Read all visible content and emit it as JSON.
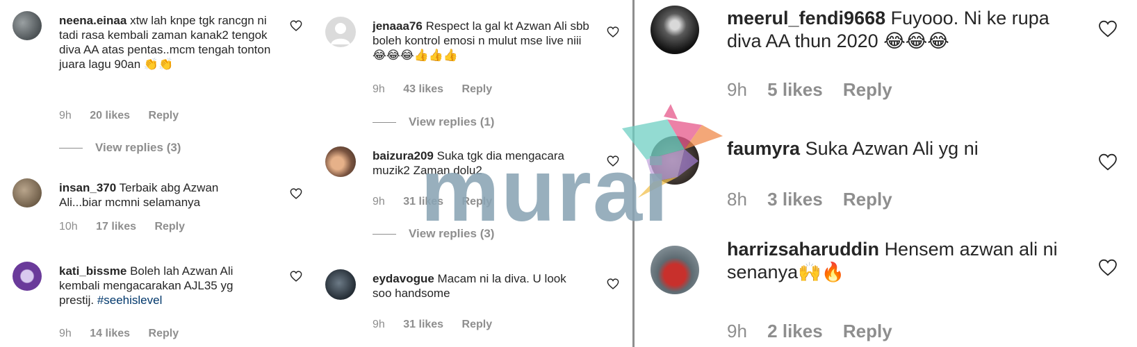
{
  "left_panel": {
    "comments": [
      {
        "username": "neena.einaa",
        "text": "xtw lah knpe tgk rancgn ni tadi rasa kembali zaman kanak2 tengok diva AA atas pentas..mcm tengah tonton juara lagu 90an 👏👏",
        "time": "9h",
        "likes": "20 likes",
        "reply": "Reply",
        "view_replies": "View replies (3)"
      },
      {
        "username": "insan_370",
        "text": "Terbaik abg Azwan Ali...biar mcmni selamanya",
        "time": "10h",
        "likes": "17 likes",
        "reply": "Reply"
      },
      {
        "username": "kati_bissme",
        "text": "Boleh lah Azwan Ali kembali mengacarakan AJL35 yg prestij.",
        "hashtag": "#seehislevel",
        "time": "9h",
        "likes": "14 likes",
        "reply": "Reply"
      }
    ]
  },
  "middle_panel": {
    "comments": [
      {
        "username": "jenaaa76",
        "text": "Respect la gal kt Azwan Ali sbb boleh kontrol emosi n mulut mse live niii😂😂😂👍👍👍",
        "time": "9h",
        "likes": "43 likes",
        "reply": "Reply",
        "view_replies": "View replies (1)"
      },
      {
        "username": "baizura209",
        "text": "Suka tgk dia mengacara muzik2 Zaman dolu2",
        "time": "9h",
        "likes": "31 likes",
        "reply": "Reply",
        "view_replies": "View replies (3)"
      },
      {
        "username": "eydavogue",
        "text": "Macam ni la diva. U look soo handsome",
        "time": "9h",
        "likes": "31 likes",
        "reply": "Reply"
      }
    ]
  },
  "right_panel": {
    "comments": [
      {
        "username": "meerul_fendi9668",
        "text": "Fuyooo. Ni ke rupa diva AA thun 2020 😂😂😂",
        "time": "9h",
        "likes": "5 likes",
        "reply": "Reply"
      },
      {
        "username": "faumyra",
        "text": "Suka Azwan Ali yg ni",
        "time": "8h",
        "likes": "3 likes",
        "reply": "Reply"
      },
      {
        "username": "harrizsaharuddin",
        "text": "Hensem azwan ali ni senanya🙌🔥",
        "time": "9h",
        "likes": "2 likes",
        "reply": "Reply"
      }
    ]
  },
  "watermark": {
    "text": "murai"
  },
  "colors": {
    "text": "#262626",
    "muted": "#8e8e8e",
    "hashtag": "#00376b",
    "watermark": "#8aa4b4",
    "divider": "#8e8e8e"
  },
  "icons": [
    "heart-icon",
    "hummingbird-logo"
  ]
}
